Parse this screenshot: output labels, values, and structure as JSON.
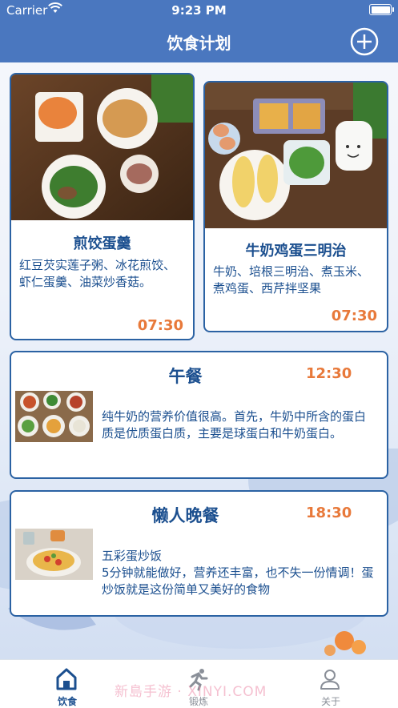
{
  "status_bar": {
    "carrier": "Carrier",
    "time": "9:23 PM"
  },
  "nav": {
    "title": "饮食计划",
    "add_icon": "plus-circle-icon"
  },
  "meals": [
    {
      "title": "煎饺蛋羹",
      "description": "红豆芡实莲子粥、冰花煎饺、虾仁蛋羹、油菜炒香菇。",
      "time": "07:30"
    },
    {
      "title": "牛奶鸡蛋三明治",
      "description": "牛奶、培根三明治、煮玉米、煮鸡蛋、西芹拌坚果",
      "time": "07:30"
    },
    {
      "title": "午餐",
      "description": "纯牛奶的营养价值很高。首先，牛奶中所含的蛋白质是优质蛋白质，主要是球蛋白和牛奶蛋白。",
      "time": "12:30"
    },
    {
      "title": "懒人晚餐",
      "description": "五彩蛋炒饭\n5分钟就能做好，营养还丰富，也不失一份情调！蛋炒饭就是这份简单又美好的食物",
      "time": "18:30"
    }
  ],
  "tabs": [
    {
      "label": "饮食",
      "icon": "home-icon",
      "active": true
    },
    {
      "label": "锻炼",
      "icon": "running-icon",
      "active": false
    },
    {
      "label": "关于",
      "icon": "person-icon",
      "active": false
    }
  ],
  "watermark": "新島手游 · XINYI.COM",
  "colors": {
    "nav_bg": "#4a77bf",
    "card_border": "#2b62a3",
    "title_text": "#1b4f8f",
    "time_text": "#e8793a"
  }
}
